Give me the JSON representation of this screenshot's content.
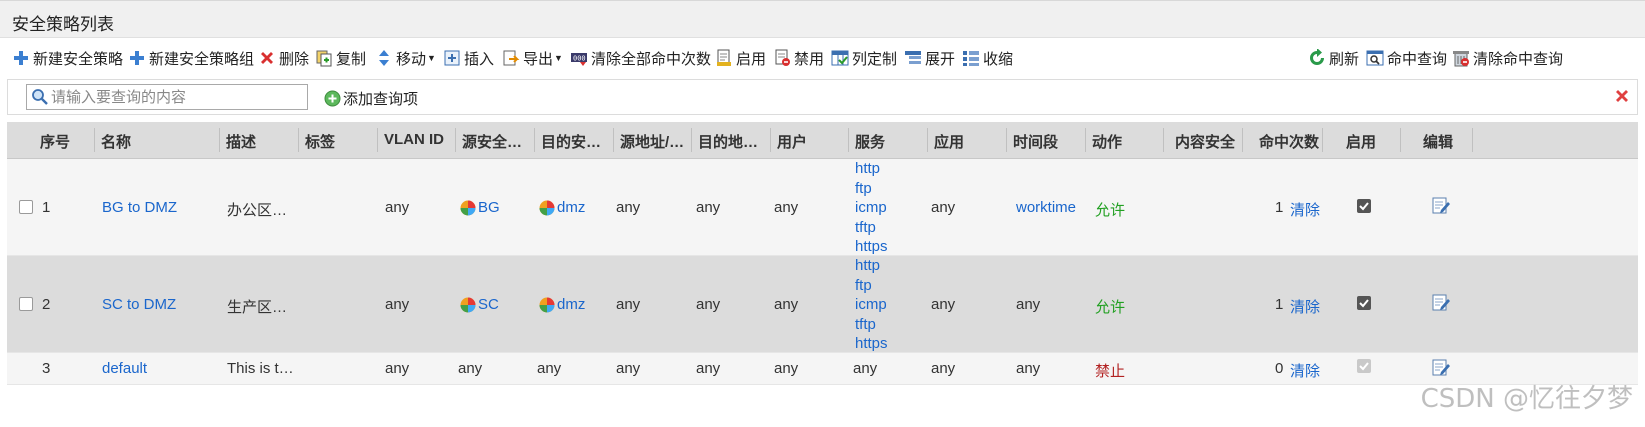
{
  "title": "安全策略列表",
  "toolbar": {
    "new_policy": "新建安全策略",
    "new_group": "新建安全策略组",
    "delete": "删除",
    "copy": "复制",
    "move": "移动",
    "insert": "插入",
    "export": "导出",
    "clear_all_hits": "清除全部命中次数",
    "enable": "启用",
    "disable": "禁用",
    "columns": "列定制",
    "expand": "展开",
    "collapse": "收缩",
    "refresh": "刷新",
    "hit_query": "命中查询",
    "clear_hit_query": "清除命中查询"
  },
  "search": {
    "placeholder": "请输入要查询的内容",
    "add_query": "添加查询项"
  },
  "columns": [
    "序号",
    "名称",
    "描述",
    "标签",
    "VLAN ID",
    "源安全…",
    "目的安…",
    "源地址/…",
    "目的地…",
    "用户",
    "服务",
    "应用",
    "时间段",
    "动作",
    "内容安全",
    "命中次数",
    "启用",
    "编辑"
  ],
  "rows": [
    {
      "no": "1",
      "name": "BG to DMZ",
      "desc": "办公区…",
      "tag": "",
      "vlan": "any",
      "src_zone": "BG",
      "dst_zone": "dmz",
      "src_addr": "any",
      "dst_addr": "any",
      "user": "any",
      "services": [
        "http",
        "ftp",
        "icmp",
        "tftp",
        "https"
      ],
      "app": "any",
      "time": "worktime",
      "action": "允许",
      "content": "",
      "hits": "1",
      "clear": "清除",
      "enabled": true
    },
    {
      "no": "2",
      "name": "SC to DMZ",
      "desc": "生产区…",
      "tag": "",
      "vlan": "any",
      "src_zone": "SC",
      "dst_zone": "dmz",
      "src_addr": "any",
      "dst_addr": "any",
      "user": "any",
      "services": [
        "http",
        "ftp",
        "icmp",
        "tftp",
        "https"
      ],
      "app": "any",
      "time": "any",
      "action": "允许",
      "content": "",
      "hits": "1",
      "clear": "清除",
      "enabled": true
    },
    {
      "no": "3",
      "name": "default",
      "desc": "This is t…",
      "tag": "",
      "vlan": "any",
      "src_zone": "any",
      "dst_zone": "any",
      "src_addr": "any",
      "dst_addr": "any",
      "user": "any",
      "services": [
        "any"
      ],
      "app": "any",
      "time": "any",
      "action": "禁止",
      "content": "",
      "hits": "0",
      "clear": "清除",
      "enabled": true
    }
  ],
  "watermark": "CSDN @忆往夕梦",
  "colors": {
    "link": "#1a66cc",
    "allow": "#22a022",
    "deny": "#b22222",
    "header_bg": "#dcdcdc",
    "row_alt_bg": "#dcdcdc"
  },
  "icons": [
    "plus-icon",
    "delete-x-icon",
    "copy-icon",
    "move-icon",
    "insert-icon",
    "export-icon",
    "counter-icon",
    "enable-icon",
    "disable-icon",
    "column-icon",
    "expand-icon",
    "collapse-icon",
    "refresh-icon",
    "query-icon",
    "clear-query-icon",
    "search-icon",
    "add-circle-icon",
    "close-icon",
    "zone-pie-icon",
    "edit-icon"
  ]
}
